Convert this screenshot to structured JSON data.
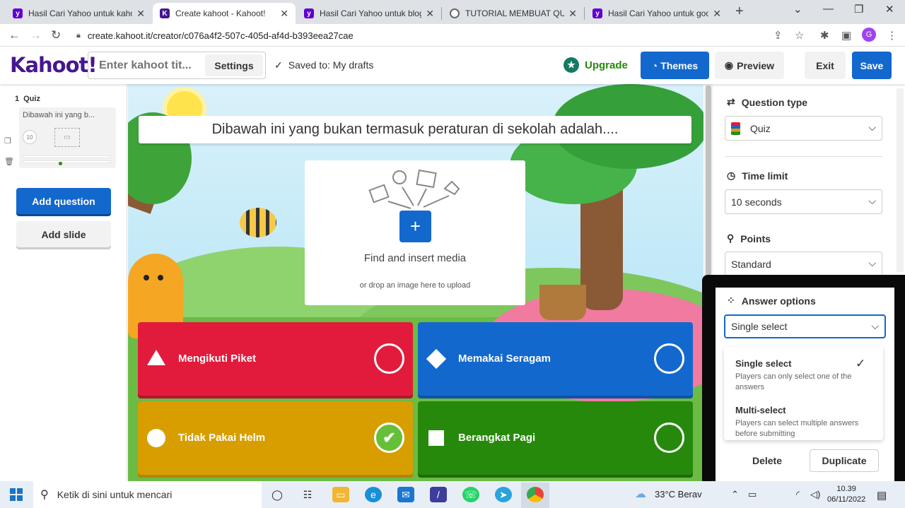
{
  "browser": {
    "tabs": [
      {
        "title": "Hasil Cari Yahoo untuk kahoot",
        "icon": "yahoo-icon"
      },
      {
        "title": "Create kahoot - Kahoot!",
        "icon": "kahoot-icon",
        "active": true
      },
      {
        "title": "Hasil Cari Yahoo untuk blog c",
        "icon": "yahoo-icon"
      },
      {
        "title": "TUTORIAL MEMBUAT QUIS C",
        "icon": "globe-icon"
      },
      {
        "title": "Hasil Cari Yahoo untuk goog",
        "icon": "yahoo-icon"
      }
    ],
    "url": "create.kahoot.it/creator/c076a4f2-507c-405d-af4d-b393eea27cae",
    "profile_initial": "G"
  },
  "header": {
    "logo": "Kahoot!",
    "title_placeholder": "Enter kahoot tit...",
    "settings_label": "Settings",
    "saved_text": "Saved to: My drafts",
    "upgrade_label": "Upgrade",
    "themes_label": "Themes",
    "preview_label": "Preview",
    "exit_label": "Exit",
    "save_label": "Save"
  },
  "sidebar": {
    "slide_number": "1",
    "slide_type": "Quiz",
    "slide_preview": "Dibawah ini yang b...",
    "slide_time": "10",
    "add_question_label": "Add question",
    "add_slide_label": "Add slide"
  },
  "question": {
    "text": "Dibawah ini yang bukan termasuk peraturan di sekolah adalah....",
    "media_find": "Find and insert media",
    "media_drop": "or drop an image here to upload",
    "answers": [
      {
        "label": "Mengikuti Piket",
        "color": "#e21b3c",
        "shape": "triangle",
        "correct": false
      },
      {
        "label": "Memakai Seragam",
        "color": "#1368ce",
        "shape": "diamond",
        "correct": false
      },
      {
        "label": "Tidak Pakai Helm",
        "color": "#d89e00",
        "shape": "circle",
        "correct": true
      },
      {
        "label": "Berangkat Pagi",
        "color": "#26890c",
        "shape": "square",
        "correct": false
      }
    ]
  },
  "settings_panel": {
    "question_type_label": "Question type",
    "question_type_value": "Quiz",
    "time_limit_label": "Time limit",
    "time_limit_value": "10 seconds",
    "points_label": "Points",
    "points_value": "Standard",
    "answer_options_label": "Answer options",
    "answer_options_value": "Single select",
    "options": [
      {
        "title": "Single select",
        "desc": "Players can only select one of the answers"
      },
      {
        "title": "Multi-select",
        "desc": "Players can select multiple answers before submitting"
      }
    ],
    "delete_label": "Delete",
    "duplicate_label": "Duplicate"
  },
  "taskbar": {
    "search_placeholder": "Ketik di sini untuk mencari",
    "weather": "33°C  Berav",
    "time": "10.39",
    "date": "06/11/2022"
  }
}
